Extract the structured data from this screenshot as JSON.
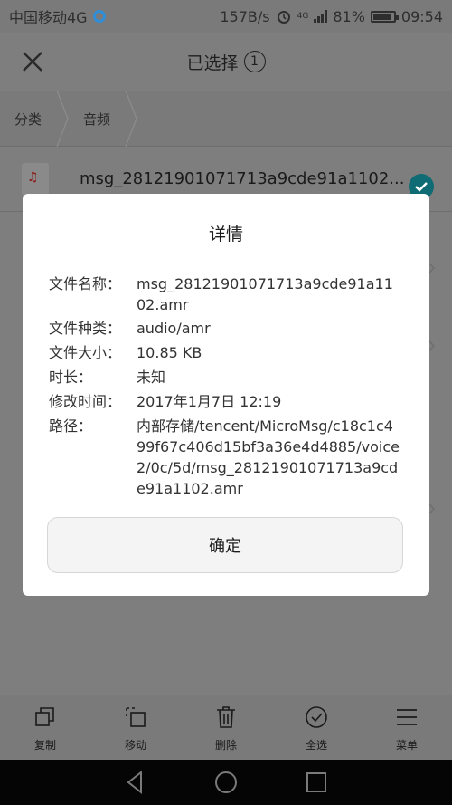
{
  "status": {
    "carrier": "中国移动4G",
    "speed": "157B/s",
    "network": "4G",
    "battery": "81%",
    "time": "09:54"
  },
  "header": {
    "title": "已选择",
    "count": "1"
  },
  "breadcrumb": [
    "分类",
    "音频"
  ],
  "file": {
    "name": "msg_28121901071713a9cde91a1102...",
    "icon": "audio-file-icon"
  },
  "dialog": {
    "title": "详情",
    "rows": [
      {
        "label": "文件名称：",
        "value": "msg_28121901071713a9cde91a1102.amr"
      },
      {
        "label": "文件种类：",
        "value": "audio/amr"
      },
      {
        "label": "文件大小：",
        "value": "10.85 KB"
      },
      {
        "label": "时长：",
        "value": "未知"
      },
      {
        "label": "修改时间：",
        "value": "2017年1月7日 12:19"
      },
      {
        "label": "路径：",
        "value": "内部存储/tencent/MicroMsg/c18c1c499f67c406d15bf3a36e4d4885/voice2/0c/5d/msg_28121901071713a9cde91a1102.amr"
      }
    ],
    "ok_label": "确定"
  },
  "actions": [
    {
      "label": "复制",
      "icon": "copy-icon"
    },
    {
      "label": "移动",
      "icon": "move-icon"
    },
    {
      "label": "删除",
      "icon": "delete-icon"
    },
    {
      "label": "全选",
      "icon": "select-all-icon"
    },
    {
      "label": "菜单",
      "icon": "menu-icon"
    }
  ],
  "colors": {
    "accent": "#0f6c75",
    "scrim": "#7e7e7e",
    "dialog_bg": "#ffffff",
    "nav_bg": "#050505"
  }
}
